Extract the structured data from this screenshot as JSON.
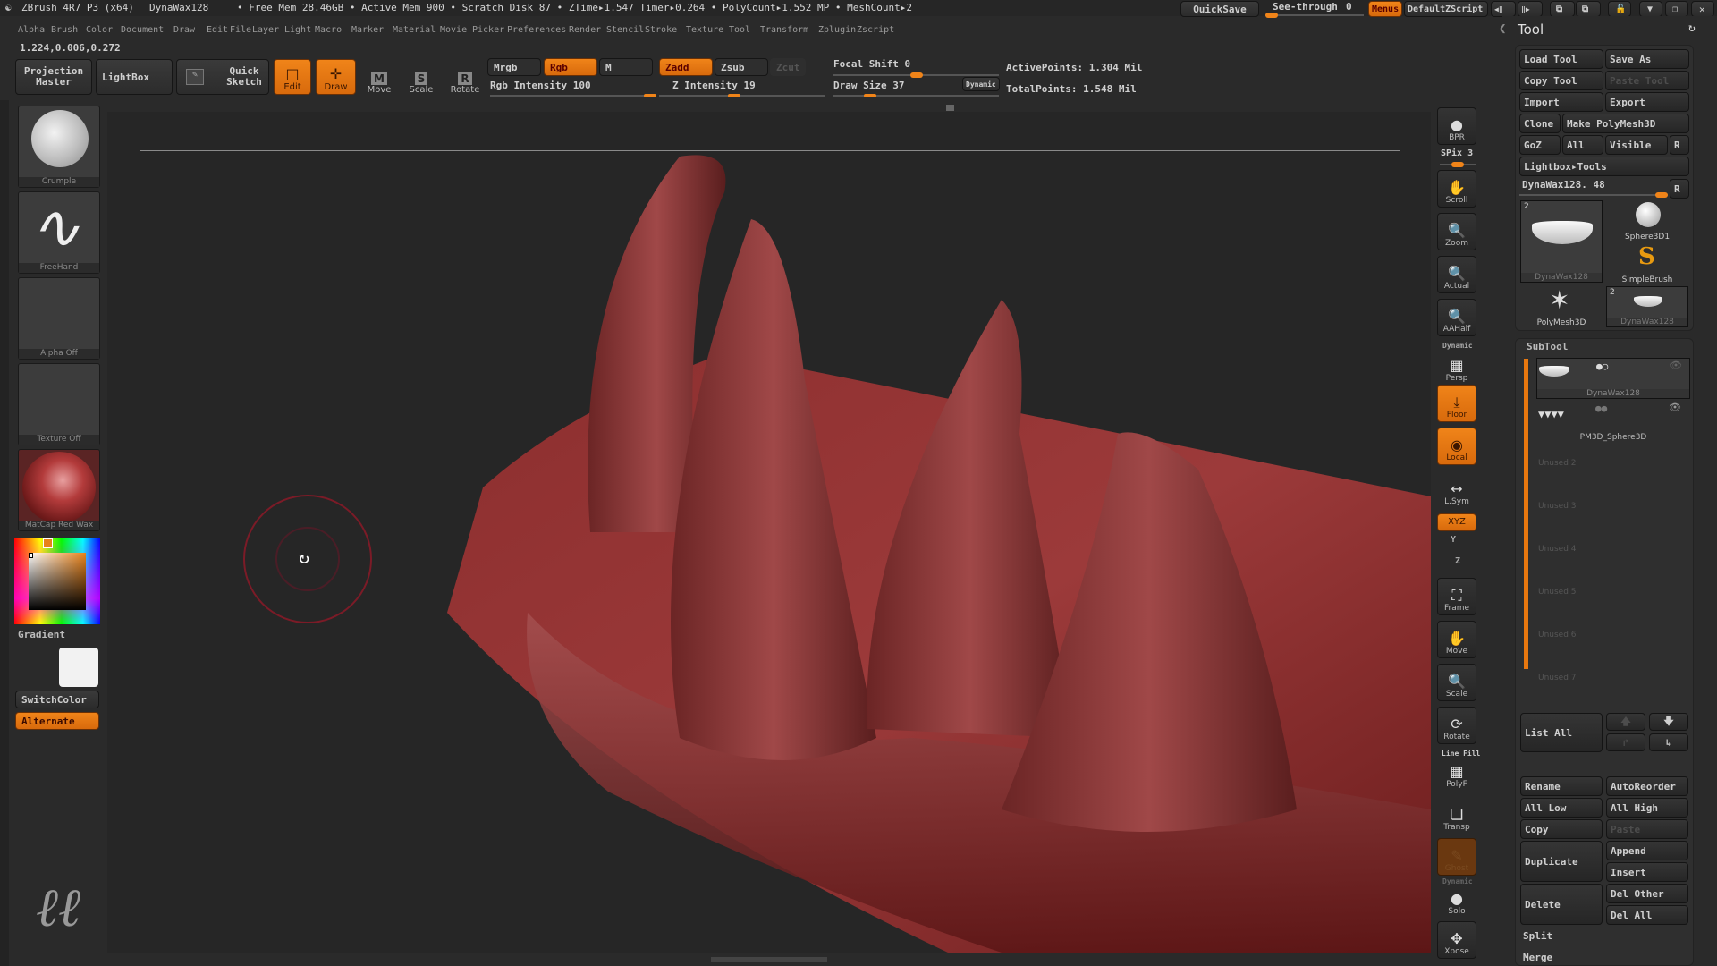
{
  "titlebar": {
    "app": "ZBrush 4R7 P3 (x64)",
    "document": "DynaWax128",
    "stats": "• Free Mem 28.46GB • Active Mem 900 • Scratch Disk 87 •  ZTime▸1.547 Timer▸0.264 • PolyCount▸1.552 MP  • MeshCount▸2",
    "quicksave": "QuickSave",
    "see_through_label": "See-through",
    "see_through_value": "0",
    "see_through_level": 0.0,
    "menus": "Menus",
    "default_zscript": "DefaultZScript"
  },
  "menubar": [
    "Alpha",
    "Brush",
    "Color",
    "Document",
    "Draw",
    "Edit",
    "File",
    "Layer",
    "Light",
    "Macro",
    "Marker",
    "Material",
    "Movie",
    "Picker",
    "Preferences",
    "Render",
    "Stencil",
    "Stroke",
    "Texture",
    "Tool",
    "Transform",
    "Zplugin",
    "Zscript"
  ],
  "coords": "1.224,0.006,0.272",
  "toolbar": {
    "projection_master": "Projection Master",
    "lightbox": "LightBox",
    "quick_sketch": "Quick Sketch",
    "edit": "Edit",
    "draw": "Draw",
    "move": "Move",
    "scale": "Scale",
    "rotate": "Rotate",
    "mrgb": "Mrgb",
    "rgb": "Rgb",
    "m": "M",
    "rgb_intensity": "Rgb Intensity 100",
    "rgb_intensity_value": 100,
    "zadd": "Zadd",
    "zsub": "Zsub",
    "zcut": "Zcut",
    "z_intensity": "Z Intensity 19",
    "z_intensity_value": 19,
    "focal_shift": "Focal Shift 0",
    "focal_shift_value": 0,
    "draw_size": "Draw Size 37",
    "draw_size_value": 37,
    "dynamic": "Dynamic",
    "active_points": "ActivePoints: 1.304 Mil",
    "total_points": "TotalPoints: 1.548 Mil"
  },
  "left": {
    "brush": "Crumple",
    "stroke": "FreeHand",
    "alpha": "Alpha  Off",
    "texture": "Texture  Off",
    "material": "MatCap  Red  Wax",
    "gradient": "Gradient",
    "switch_color": "SwitchColor",
    "alternate": "Alternate",
    "main_color": "#e8821a",
    "secondary_color": "#f2f2f2"
  },
  "shelf": {
    "bpr": "BPR",
    "spix": "SPix 3",
    "scroll": "Scroll",
    "zoom": "Zoom",
    "actual": "Actual",
    "aahalf": "AAHalf",
    "dynamic": "Dynamic",
    "persp": "Persp",
    "floor": "Floor",
    "local": "Local",
    "lsym": "L.Sym",
    "xyz": "XYZ",
    "y": "Y",
    "z": "Z",
    "frame": "Frame",
    "move": "Move",
    "scale": "Scale",
    "rotate": "Rotate",
    "line_fill": "Line Fill",
    "polyf": "PolyF",
    "transp": "Transp",
    "ghost": "Ghost",
    "dynamic2": "Dynamic",
    "solo": "Solo",
    "xpose": "Xpose"
  },
  "tool": {
    "title": "Tool",
    "load_tool": "Load Tool",
    "save_as": "Save As",
    "copy_tool": "Copy Tool",
    "paste_tool": "Paste Tool",
    "import": "Import",
    "export": "Export",
    "clone": "Clone",
    "make_polymesh": "Make PolyMesh3D",
    "goz": "GoZ",
    "all": "All",
    "visible": "Visible",
    "r": "R",
    "lightbox_tools": "Lightbox▸Tools",
    "current_tool": "DynaWax128. 48",
    "tiles": [
      {
        "label": "DynaWax128",
        "count": "2"
      },
      {
        "label": "Sphere3D1"
      },
      {
        "label": "SimpleBrush"
      },
      {
        "label": "PolyMesh3D"
      },
      {
        "label": "DynaWax128",
        "count": "2"
      }
    ]
  },
  "subtool": {
    "title": "SubTool",
    "items": [
      {
        "label": "DynaWax128"
      },
      {
        "label": "PM3D_Sphere3D"
      }
    ],
    "unused": [
      "Unused  2",
      "Unused  3",
      "Unused  4",
      "Unused  5",
      "Unused  6",
      "Unused  7"
    ],
    "list_all": "List  All",
    "rename": "Rename",
    "autoreorder": "AutoReorder",
    "all_low": "All  Low",
    "all_high": "All  High",
    "copy": "Copy",
    "paste": "Paste",
    "duplicate": "Duplicate",
    "append": "Append",
    "insert": "Insert",
    "delete": "Delete",
    "del_other": "Del  Other",
    "del_all": "Del  All",
    "split": "Split",
    "merge": "Merge"
  }
}
